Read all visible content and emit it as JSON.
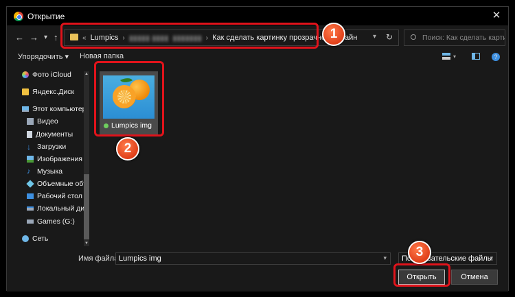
{
  "window": {
    "title": "Открытие",
    "close_glyph": "✕"
  },
  "nav": {
    "back_glyph": "←",
    "forward_glyph": "→",
    "recent_glyph": "▾",
    "up_glyph": "↑",
    "breadcrumb": [
      "Lumpics",
      "Как сделать картинку прозрачной онлайн"
    ],
    "breadcrumb_prefix": "«",
    "blurred_crumbs": [
      "▮▮▮▮▮ ▮▮▮▮",
      "▮▮▮▮▮▮▮"
    ],
    "dropdown_glyph": "▾",
    "refresh_glyph": "↻",
    "search_placeholder": "Поиск: Как сделать картин..."
  },
  "toolbar": {
    "organize_label": "Упорядочить ▾",
    "new_folder_label": "Новая папка",
    "help_glyph": "?"
  },
  "sidebar": {
    "items": [
      {
        "label": "Фото iCloud",
        "icon": "icloud-photos-icon",
        "color": "#f2a65a"
      },
      {
        "label": "Яндекс.Диск",
        "icon": "yandex-disk-icon",
        "color": "#f0c040"
      },
      {
        "label": "Этот компьютер",
        "icon": "computer-icon",
        "color": "#6fb7e8"
      },
      {
        "label": "Видео",
        "icon": "video-icon",
        "color": "#9aa7b8"
      },
      {
        "label": "Документы",
        "icon": "documents-icon",
        "color": "#cfd6df"
      },
      {
        "label": "Загрузки",
        "icon": "downloads-icon",
        "color": "#3d8fe0"
      },
      {
        "label": "Изображения",
        "icon": "pictures-icon",
        "color": "#6fb7e8"
      },
      {
        "label": "Музыка",
        "icon": "music-icon",
        "color": "#3d8fe0"
      },
      {
        "label": "Объемные объ",
        "icon": "3d-objects-icon",
        "color": "#6fc6e8"
      },
      {
        "label": "Рабочий стол",
        "icon": "desktop-icon",
        "color": "#3d8fe0"
      },
      {
        "label": "Локальный дис",
        "icon": "local-disk-icon",
        "color": "#9aa7b8"
      },
      {
        "label": "Games (G:)",
        "icon": "drive-icon",
        "color": "#9aa7b8"
      },
      {
        "label": "Сеть",
        "icon": "network-icon",
        "color": "#6fb7e8"
      }
    ]
  },
  "files": [
    {
      "name": "Lumpics img",
      "status": "synced"
    }
  ],
  "bottom": {
    "filename_label": "Имя файла:",
    "filename_value": "Lumpics img",
    "filetype_value": "Пользовательские файлы",
    "open_label": "Открыть",
    "cancel_label": "Отмена"
  },
  "annotations": {
    "badges": [
      "1",
      "2",
      "3"
    ],
    "highlight_color": "#e1131b"
  }
}
